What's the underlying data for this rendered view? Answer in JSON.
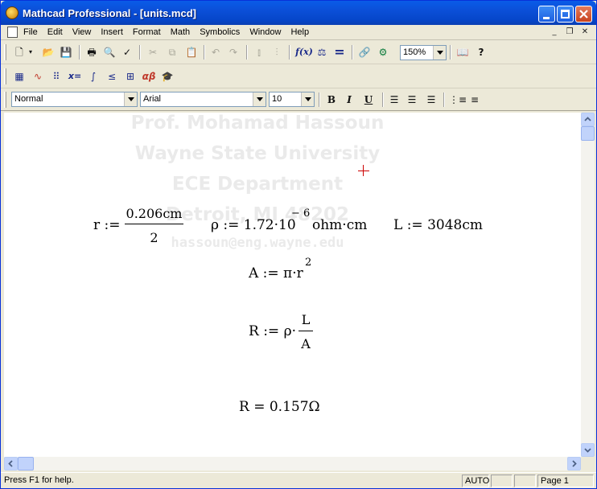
{
  "window": {
    "title": "Mathcad Professional - [units.mcd]"
  },
  "menubar": {
    "items": [
      "File",
      "Edit",
      "View",
      "Insert",
      "Format",
      "Math",
      "Symbolics",
      "Window",
      "Help"
    ]
  },
  "toolbar": {
    "zoom": "150%",
    "fx_label": "f(x)",
    "equals_label": "="
  },
  "math_toolbar": {
    "xeq_label": "x=",
    "alphabeta_label": "αβ"
  },
  "format_toolbar": {
    "style": "Normal",
    "font": "Arial",
    "size": "10",
    "bold_label": "B",
    "italic_label": "I",
    "underline_label": "U"
  },
  "watermark": {
    "lines": [
      "Prof. Mohamad Hassoun",
      "Wayne State University",
      "ECE Department",
      "Detroit, MI 48202",
      "hassoun@eng.wayne.edu"
    ]
  },
  "worksheet": {
    "r_lhs": "r :=",
    "r_num": "0.206cm",
    "r_den": "2",
    "rho_lhs": "ρ := 1.72·10",
    "rho_exp": "− 6",
    "rho_unit": "ohm·cm",
    "L_def": "L := 3048cm",
    "A_def": "A := π·r",
    "A_exp": "2",
    "R_lhs": "R := ρ·",
    "R_num": "L",
    "R_den": "A",
    "R_result": "R = 0.157Ω"
  },
  "statusbar": {
    "help_text": "Press F1 for help.",
    "mode": "AUTO",
    "page": "Page 1"
  }
}
